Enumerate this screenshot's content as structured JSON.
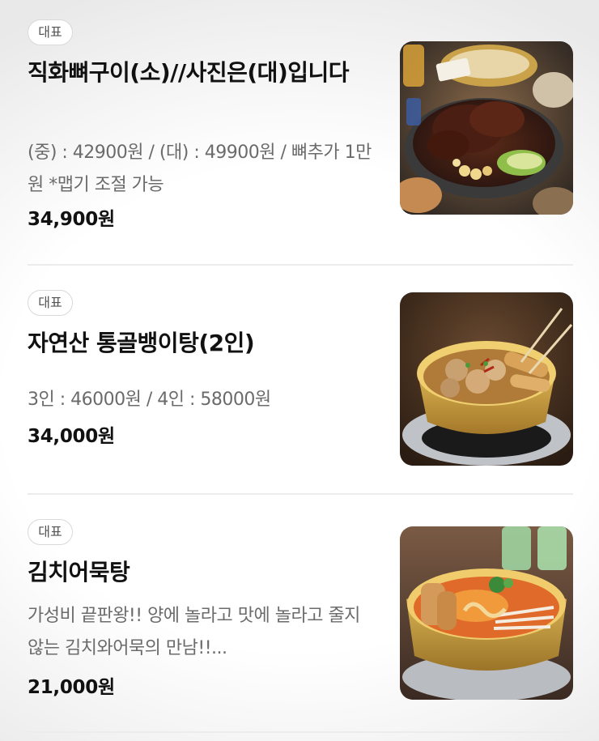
{
  "menu": {
    "items": [
      {
        "badge": "대표",
        "name": "직화뼈구이(소)//사진은(대)입니다",
        "description": "(중) : 42900원 / (대) : 49900원 / 뼈추가 1만원 *맵기 조절 가능",
        "price": "34,900원",
        "image_icon": "braised-bone-pork-photo"
      },
      {
        "badge": "대표",
        "name": "자연산 통골뱅이탕(2인)",
        "description": "3인 : 46000원 / 4인 : 58000원",
        "price": "34,000원",
        "image_icon": "whelk-stew-photo"
      },
      {
        "badge": "대표",
        "name": "김치어묵탕",
        "description": "가성비 끝판왕!! 양에 놀라고 맛에 놀라고 줄지않는 김치와어묵의 만남!!...",
        "price": "21,000원",
        "image_icon": "kimchi-fishcake-stew-photo"
      }
    ]
  }
}
